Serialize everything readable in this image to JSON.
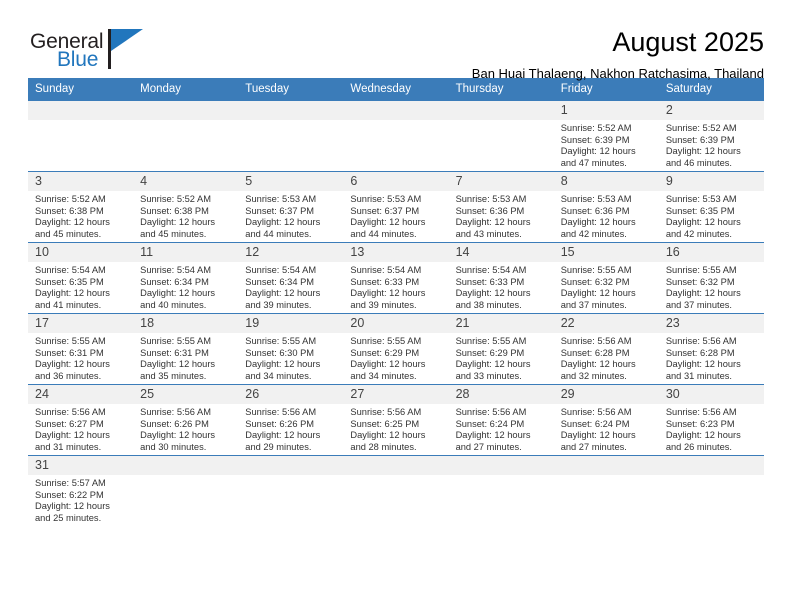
{
  "brand": {
    "name_line1": "General",
    "name_line2": "Blue",
    "accent_color": "#2176bd",
    "logo_icon": "triangle-flag-icon"
  },
  "header": {
    "title": "August 2025",
    "subtitle": "Ban Huai Thalaeng, Nakhon Ratchasima, Thailand"
  },
  "theme": {
    "header_blue": "#3b7cb9",
    "daynum_band": "#f1f1f1",
    "text": "#333333"
  },
  "calendar": {
    "weekday_headers": [
      "Sunday",
      "Monday",
      "Tuesday",
      "Wednesday",
      "Thursday",
      "Friday",
      "Saturday"
    ],
    "labels": {
      "sunrise": "Sunrise:",
      "sunset": "Sunset:",
      "daylight": "Daylight:"
    },
    "weeks": [
      [
        {
          "day": "",
          "blank": true
        },
        {
          "day": "",
          "blank": true
        },
        {
          "day": "",
          "blank": true
        },
        {
          "day": "",
          "blank": true
        },
        {
          "day": "",
          "blank": true
        },
        {
          "day": "1",
          "sunrise": "Sunrise: 5:52 AM",
          "sunset": "Sunset: 6:39 PM",
          "daylight_1": "Daylight: 12 hours",
          "daylight_2": "and 47 minutes."
        },
        {
          "day": "2",
          "sunrise": "Sunrise: 5:52 AM",
          "sunset": "Sunset: 6:39 PM",
          "daylight_1": "Daylight: 12 hours",
          "daylight_2": "and 46 minutes."
        }
      ],
      [
        {
          "day": "3",
          "sunrise": "Sunrise: 5:52 AM",
          "sunset": "Sunset: 6:38 PM",
          "daylight_1": "Daylight: 12 hours",
          "daylight_2": "and 45 minutes."
        },
        {
          "day": "4",
          "sunrise": "Sunrise: 5:52 AM",
          "sunset": "Sunset: 6:38 PM",
          "daylight_1": "Daylight: 12 hours",
          "daylight_2": "and 45 minutes."
        },
        {
          "day": "5",
          "sunrise": "Sunrise: 5:53 AM",
          "sunset": "Sunset: 6:37 PM",
          "daylight_1": "Daylight: 12 hours",
          "daylight_2": "and 44 minutes."
        },
        {
          "day": "6",
          "sunrise": "Sunrise: 5:53 AM",
          "sunset": "Sunset: 6:37 PM",
          "daylight_1": "Daylight: 12 hours",
          "daylight_2": "and 44 minutes."
        },
        {
          "day": "7",
          "sunrise": "Sunrise: 5:53 AM",
          "sunset": "Sunset: 6:36 PM",
          "daylight_1": "Daylight: 12 hours",
          "daylight_2": "and 43 minutes."
        },
        {
          "day": "8",
          "sunrise": "Sunrise: 5:53 AM",
          "sunset": "Sunset: 6:36 PM",
          "daylight_1": "Daylight: 12 hours",
          "daylight_2": "and 42 minutes."
        },
        {
          "day": "9",
          "sunrise": "Sunrise: 5:53 AM",
          "sunset": "Sunset: 6:35 PM",
          "daylight_1": "Daylight: 12 hours",
          "daylight_2": "and 42 minutes."
        }
      ],
      [
        {
          "day": "10",
          "sunrise": "Sunrise: 5:54 AM",
          "sunset": "Sunset: 6:35 PM",
          "daylight_1": "Daylight: 12 hours",
          "daylight_2": "and 41 minutes."
        },
        {
          "day": "11",
          "sunrise": "Sunrise: 5:54 AM",
          "sunset": "Sunset: 6:34 PM",
          "daylight_1": "Daylight: 12 hours",
          "daylight_2": "and 40 minutes."
        },
        {
          "day": "12",
          "sunrise": "Sunrise: 5:54 AM",
          "sunset": "Sunset: 6:34 PM",
          "daylight_1": "Daylight: 12 hours",
          "daylight_2": "and 39 minutes."
        },
        {
          "day": "13",
          "sunrise": "Sunrise: 5:54 AM",
          "sunset": "Sunset: 6:33 PM",
          "daylight_1": "Daylight: 12 hours",
          "daylight_2": "and 39 minutes."
        },
        {
          "day": "14",
          "sunrise": "Sunrise: 5:54 AM",
          "sunset": "Sunset: 6:33 PM",
          "daylight_1": "Daylight: 12 hours",
          "daylight_2": "and 38 minutes."
        },
        {
          "day": "15",
          "sunrise": "Sunrise: 5:55 AM",
          "sunset": "Sunset: 6:32 PM",
          "daylight_1": "Daylight: 12 hours",
          "daylight_2": "and 37 minutes."
        },
        {
          "day": "16",
          "sunrise": "Sunrise: 5:55 AM",
          "sunset": "Sunset: 6:32 PM",
          "daylight_1": "Daylight: 12 hours",
          "daylight_2": "and 37 minutes."
        }
      ],
      [
        {
          "day": "17",
          "sunrise": "Sunrise: 5:55 AM",
          "sunset": "Sunset: 6:31 PM",
          "daylight_1": "Daylight: 12 hours",
          "daylight_2": "and 36 minutes."
        },
        {
          "day": "18",
          "sunrise": "Sunrise: 5:55 AM",
          "sunset": "Sunset: 6:31 PM",
          "daylight_1": "Daylight: 12 hours",
          "daylight_2": "and 35 minutes."
        },
        {
          "day": "19",
          "sunrise": "Sunrise: 5:55 AM",
          "sunset": "Sunset: 6:30 PM",
          "daylight_1": "Daylight: 12 hours",
          "daylight_2": "and 34 minutes."
        },
        {
          "day": "20",
          "sunrise": "Sunrise: 5:55 AM",
          "sunset": "Sunset: 6:29 PM",
          "daylight_1": "Daylight: 12 hours",
          "daylight_2": "and 34 minutes."
        },
        {
          "day": "21",
          "sunrise": "Sunrise: 5:55 AM",
          "sunset": "Sunset: 6:29 PM",
          "daylight_1": "Daylight: 12 hours",
          "daylight_2": "and 33 minutes."
        },
        {
          "day": "22",
          "sunrise": "Sunrise: 5:56 AM",
          "sunset": "Sunset: 6:28 PM",
          "daylight_1": "Daylight: 12 hours",
          "daylight_2": "and 32 minutes."
        },
        {
          "day": "23",
          "sunrise": "Sunrise: 5:56 AM",
          "sunset": "Sunset: 6:28 PM",
          "daylight_1": "Daylight: 12 hours",
          "daylight_2": "and 31 minutes."
        }
      ],
      [
        {
          "day": "24",
          "sunrise": "Sunrise: 5:56 AM",
          "sunset": "Sunset: 6:27 PM",
          "daylight_1": "Daylight: 12 hours",
          "daylight_2": "and 31 minutes."
        },
        {
          "day": "25",
          "sunrise": "Sunrise: 5:56 AM",
          "sunset": "Sunset: 6:26 PM",
          "daylight_1": "Daylight: 12 hours",
          "daylight_2": "and 30 minutes."
        },
        {
          "day": "26",
          "sunrise": "Sunrise: 5:56 AM",
          "sunset": "Sunset: 6:26 PM",
          "daylight_1": "Daylight: 12 hours",
          "daylight_2": "and 29 minutes."
        },
        {
          "day": "27",
          "sunrise": "Sunrise: 5:56 AM",
          "sunset": "Sunset: 6:25 PM",
          "daylight_1": "Daylight: 12 hours",
          "daylight_2": "and 28 minutes."
        },
        {
          "day": "28",
          "sunrise": "Sunrise: 5:56 AM",
          "sunset": "Sunset: 6:24 PM",
          "daylight_1": "Daylight: 12 hours",
          "daylight_2": "and 27 minutes."
        },
        {
          "day": "29",
          "sunrise": "Sunrise: 5:56 AM",
          "sunset": "Sunset: 6:24 PM",
          "daylight_1": "Daylight: 12 hours",
          "daylight_2": "and 27 minutes."
        },
        {
          "day": "30",
          "sunrise": "Sunrise: 5:56 AM",
          "sunset": "Sunset: 6:23 PM",
          "daylight_1": "Daylight: 12 hours",
          "daylight_2": "and 26 minutes."
        }
      ],
      [
        {
          "day": "31",
          "sunrise": "Sunrise: 5:57 AM",
          "sunset": "Sunset: 6:22 PM",
          "daylight_1": "Daylight: 12 hours",
          "daylight_2": "and 25 minutes."
        },
        {
          "day": "",
          "blank": true
        },
        {
          "day": "",
          "blank": true
        },
        {
          "day": "",
          "blank": true
        },
        {
          "day": "",
          "blank": true
        },
        {
          "day": "",
          "blank": true
        },
        {
          "day": "",
          "blank": true
        }
      ]
    ]
  }
}
